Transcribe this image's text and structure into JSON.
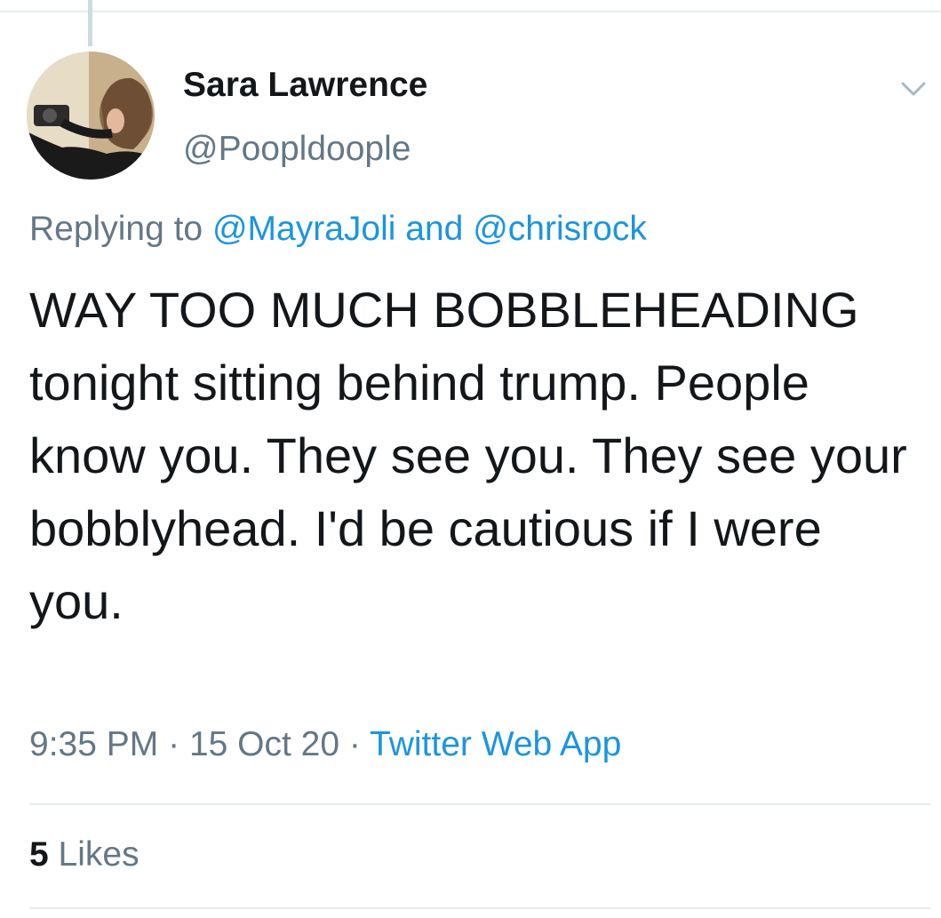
{
  "tweet": {
    "author": {
      "display_name": "Sara Lawrence",
      "handle": "@Poopldoople"
    },
    "reply": {
      "prefix": "Replying to",
      "user1": "@MayraJoli",
      "conjunction": "and",
      "user2": "@chrisrock"
    },
    "text": "WAY TOO MUCH BOBBLEHEADING tonight sitting behind trump. People know you. They see you. They see your bobblyhead. I'd be cautious if I were you.",
    "time": "9:35 PM",
    "date": "15 Oct 20",
    "separator": "·",
    "source": "Twitter Web App",
    "likes": {
      "count": "5",
      "label": "Likes"
    }
  },
  "colors": {
    "text": "#14171a",
    "secondary": "#657786",
    "link": "#1b95e0",
    "border": "#e6ecf0"
  },
  "icons": {
    "more": "chevron-down-icon",
    "avatar": "profile-photo"
  }
}
